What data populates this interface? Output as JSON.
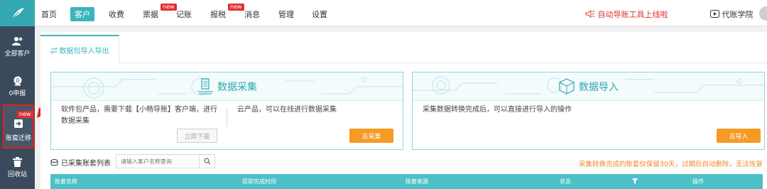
{
  "nav": {
    "items": [
      "首页",
      "客户",
      "收费",
      "票据",
      "记账",
      "报税",
      "消息",
      "管理",
      "设置"
    ],
    "active_index": 1,
    "new_badge": "new",
    "notice_link": "自动导账工具上线啦",
    "academy_link": "代账学院"
  },
  "sidebar": {
    "all_clients": "全部客户",
    "zero_report": "0申报",
    "account_migration": "账套迁移",
    "recycle_bin": "回收站",
    "new_badge": "new"
  },
  "tab": {
    "label": "数据包导入导出"
  },
  "collect_card": {
    "title": "数据采集",
    "software_text_1": "软件包产品，需要下载【小畅导账】客户端，进行",
    "software_text_2": "数据采集",
    "cloud_text": "云产品，可以在线进行数据采集",
    "download_button": "立即下载",
    "collect_button": "去采集"
  },
  "import_card": {
    "title": "数据导入",
    "text": "采集数据转换完成后，可以直接进行导入的操作",
    "import_button": "去导入"
  },
  "list": {
    "title": "已采集账套列表",
    "search_placeholder": "请输入客户名称查询",
    "notice": "采集转换完成的账套仅保留30天，过期后自动删除，无法恢复",
    "columns": [
      "账套名称",
      "提取完成时间",
      "账套来源",
      "状态",
      "操作"
    ]
  },
  "colors": {
    "accent": "#3bb4bd",
    "rail": "#3a4a5c",
    "orange": "#f59a23",
    "red": "#e02020"
  }
}
